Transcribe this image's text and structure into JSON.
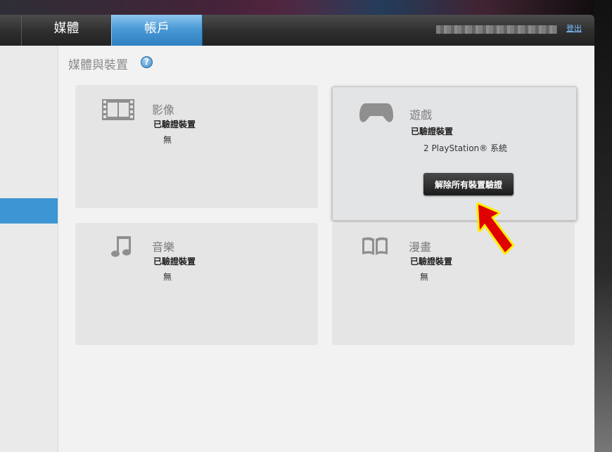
{
  "nav": {
    "tabs": [
      {
        "label": "媒體"
      },
      {
        "label": "帳戶"
      }
    ],
    "logout_label": "登出"
  },
  "page": {
    "title": "媒體與裝置",
    "help_label": "?"
  },
  "cards": [
    {
      "title": "影像",
      "icon": "film-icon",
      "sub": "已驗證裝置",
      "value": "無"
    },
    {
      "title": "遊戲",
      "icon": "gamepad-icon",
      "sub": "已驗證裝置",
      "value": "2 PlayStation® 系統",
      "button": "解除所有裝置驗證"
    },
    {
      "title": "音樂",
      "icon": "music-note-icon",
      "sub": "已驗證裝置",
      "value": "無"
    },
    {
      "title": "漫畫",
      "icon": "book-icon",
      "sub": "已驗證裝置",
      "value": "無"
    }
  ],
  "colors": {
    "accent": "#3d95d3",
    "annotation_arrow": "#e00000",
    "annotation_outline": "#ffee00"
  }
}
